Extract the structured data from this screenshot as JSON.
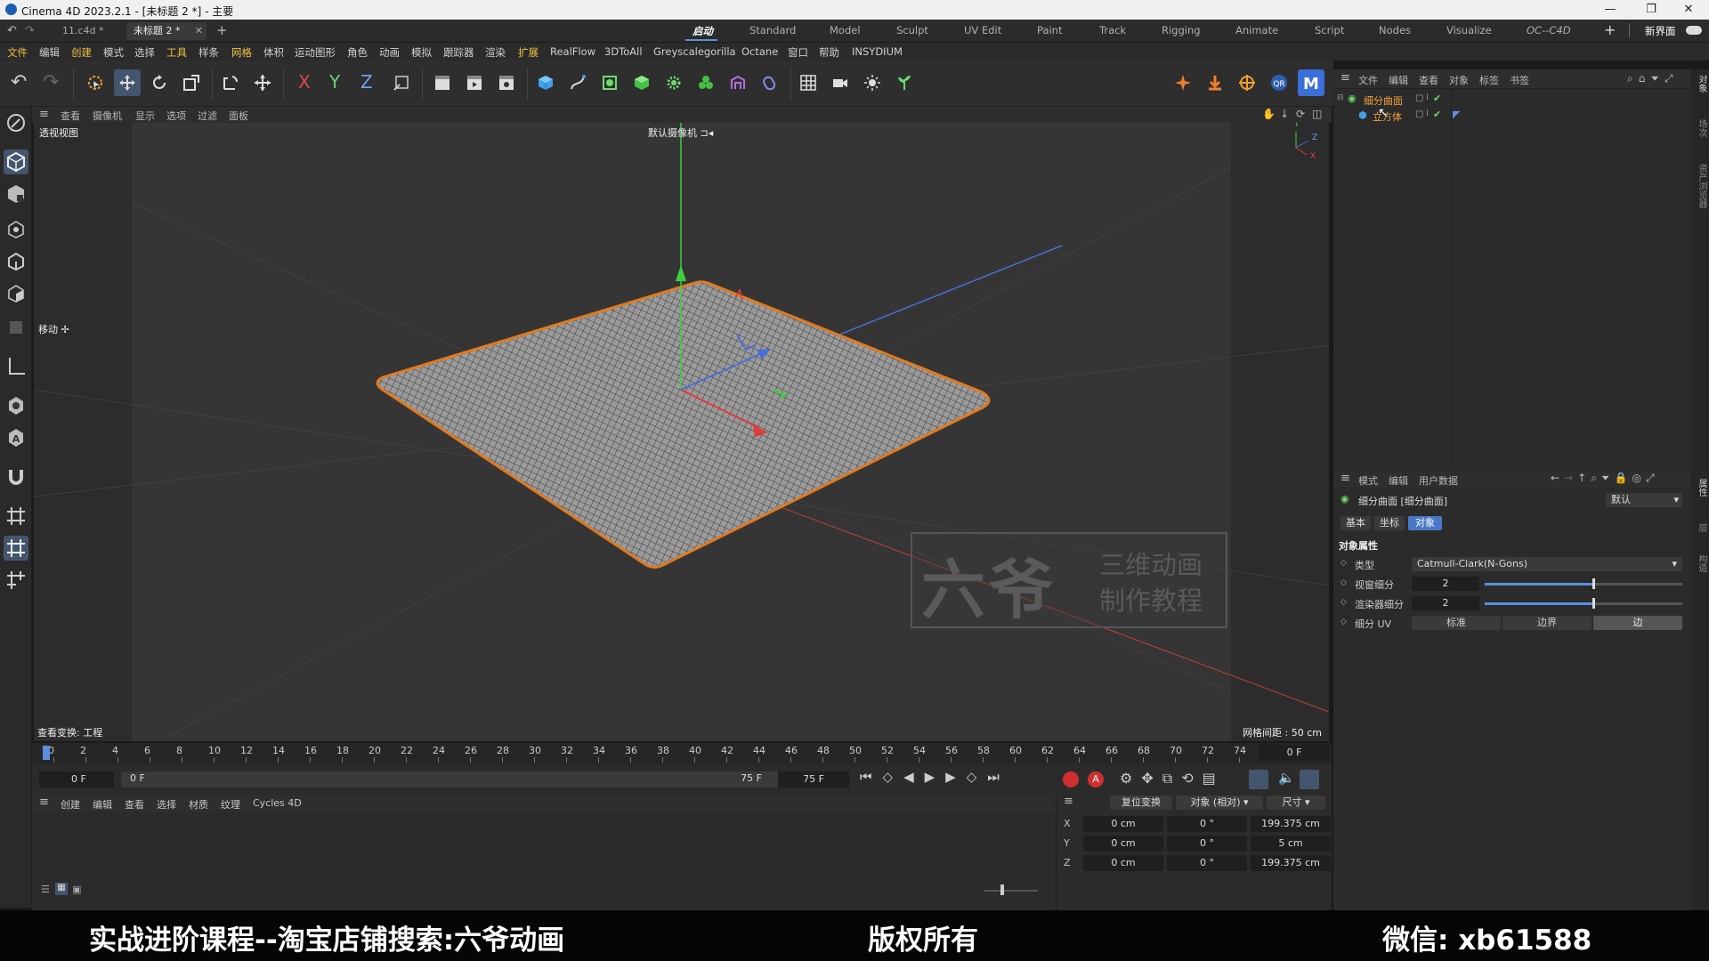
{
  "window": {
    "title": "Cinema 4D 2023.2.1 - [未标题 2 *] - 主要",
    "controls": [
      "—",
      "❐",
      "✕"
    ]
  },
  "doc_tabs": [
    {
      "label": "11.c4d *"
    },
    {
      "label": "未标题 2 *"
    }
  ],
  "layouts": [
    "启动",
    "Standard",
    "Model",
    "Sculpt",
    "UV Edit",
    "Paint",
    "Track",
    "Rigging",
    "Animate",
    "Script",
    "Nodes",
    "Visualize",
    "OC--C4D"
  ],
  "new_layout_label": "新界面",
  "menu": [
    "文件",
    "编辑",
    "创建",
    "模式",
    "选择",
    "工具",
    "样条",
    "网格",
    "体积",
    "运动图形",
    "角色",
    "动画",
    "模拟",
    "跟踪器",
    "渲染",
    "扩展",
    "RealFlow",
    "3DToAll",
    "Greyscalegorilla",
    "Octane",
    "窗口",
    "帮助",
    "INSYDIUM"
  ],
  "viewport": {
    "menu": [
      "查看",
      "摄像机",
      "显示",
      "选项",
      "过滤",
      "面板"
    ],
    "view_name": "透视视图",
    "camera_label": "默认摄像机",
    "tool_label": "移动",
    "status_left": "查看变换: 工程",
    "grid_spacing": "网格间距 : 50 cm",
    "watermark_big": "六爷",
    "watermark_line1": "三维动画",
    "watermark_line2": "制作教程",
    "axis_labels": {
      "y": "Y",
      "z": "Z",
      "x": "X"
    }
  },
  "timeline": {
    "ticks": [
      "0",
      "2",
      "4",
      "6",
      "8",
      "10",
      "12",
      "14",
      "16",
      "18",
      "20",
      "22",
      "24",
      "26",
      "28",
      "30",
      "32",
      "34",
      "36",
      "38",
      "40",
      "42",
      "44",
      "46",
      "48",
      "50",
      "52",
      "54",
      "56",
      "58",
      "60",
      "62",
      "64",
      "66",
      "68",
      "70",
      "72",
      "74"
    ],
    "current_frame": "0 F",
    "start_field": "0 F",
    "range_start": "0 F",
    "range_end": "75 F",
    "end_field": "75 F"
  },
  "material_bar": [
    "创建",
    "编辑",
    "查看",
    "选择",
    "材质",
    "纹理",
    "Cycles 4D"
  ],
  "coord_panel": {
    "reset_label": "复位变换",
    "mode_label": "对象 (相对)",
    "size_label": "尺寸",
    "rows": [
      {
        "axis": "X",
        "pos": "0 cm",
        "rot": "0 °",
        "size": "199.375 cm"
      },
      {
        "axis": "Y",
        "pos": "0 cm",
        "rot": "0 °",
        "size": "5 cm"
      },
      {
        "axis": "Z",
        "pos": "0 cm",
        "rot": "0 °",
        "size": "199.375 cm"
      }
    ]
  },
  "object_manager": {
    "menu": [
      "文件",
      "编辑",
      "查看",
      "对象",
      "标签",
      "书签"
    ],
    "objects": [
      {
        "name": "细分曲面",
        "color": "#f2a33a"
      },
      {
        "name": "立方体",
        "color": "#f2a33a"
      }
    ]
  },
  "attribute_manager": {
    "menu": [
      "模式",
      "编辑",
      "用户数据"
    ],
    "object_title": "细分曲面 [细分曲面]",
    "preset": "默认",
    "tabs": [
      "基本",
      "坐标",
      "对象"
    ],
    "active_tab": "对象",
    "section": "对象属性",
    "params": [
      {
        "label": "类型",
        "value": "Catmull-Clark(N-Gons)"
      },
      {
        "label": "视窗细分",
        "value": "2",
        "slider": 0.55
      },
      {
        "label": "渲染器细分",
        "value": "2",
        "slider": 0.55
      }
    ],
    "uv_label": "细分 UV",
    "uv_options": [
      "标准",
      "边界",
      "边"
    ],
    "uv_active": "边"
  },
  "right_strip": [
    "对象",
    "场次",
    "资产浏览器",
    "属性",
    "层",
    "构造"
  ],
  "caption": {
    "left": "实战进阶课程--淘宝店铺搜索:六爷动画",
    "center": "版权所有",
    "right": "微信: xb61588"
  },
  "colors": {
    "accent_blue": "#5b8fe0",
    "selection_orange": "#e07a20",
    "axis_red": "#e03a3a",
    "axis_green": "#3ecf3e",
    "axis_blue": "#3a6fe0"
  }
}
